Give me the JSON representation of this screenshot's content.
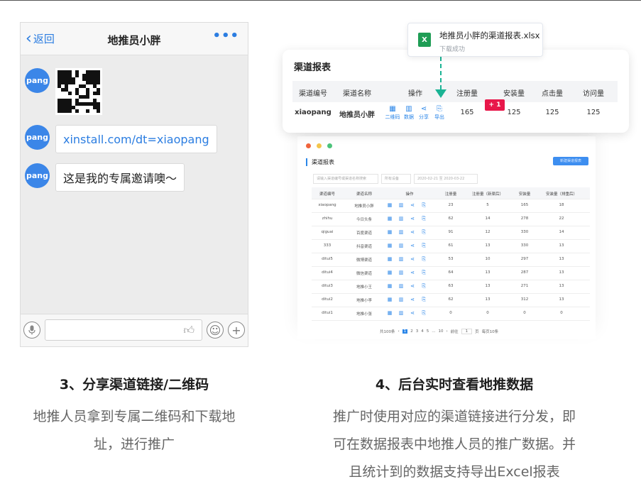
{
  "left": {
    "nav": {
      "back_label": "返回",
      "title": "地推员小胖",
      "more": "•••"
    },
    "messages": [
      {
        "avatar": "pang",
        "type": "qrcode"
      },
      {
        "avatar": "pang",
        "type": "link",
        "text": "xinstall.com/dt=xiaopang"
      },
      {
        "avatar": "pang",
        "type": "text",
        "text": "这是我的专属邀请噢～"
      }
    ],
    "input": {
      "voice_icon": "mic-icon",
      "like_icon": "thumb-icon",
      "emoji_icon": "emoji-icon",
      "add_icon": "plus-icon"
    },
    "caption_title": "3、分享渠道链接/二维码",
    "caption_line1": "地推人员拿到专属二维码和下载地",
    "caption_line2": "址，进行推广"
  },
  "right": {
    "file": {
      "name": "地推员小胖的渠道报表.xlsx",
      "status": "下载成功",
      "icon": "excel-icon"
    },
    "report": {
      "title": "渠道报表",
      "headers": [
        "渠道编号",
        "渠道名称",
        "操作",
        "注册量",
        "安装量",
        "点击量",
        "访问量"
      ],
      "row": {
        "code": "xiaopang",
        "name": "地推员小胖",
        "register": "165",
        "install": "125",
        "click": "125",
        "visit": "125"
      },
      "ops": [
        "二维码",
        "数据",
        "分享",
        "导出"
      ],
      "badge": "+ 1"
    },
    "screen": {
      "title": "渠道报表",
      "button": "新建渠道报表",
      "search_placeholder": "请输入渠道编号或渠道名称搜索",
      "select": "所有设备",
      "date_range": "2020-02-21 至 2020-03-22",
      "headers": [
        "渠道编号",
        "渠道名称",
        "操作",
        "注册量",
        "注册量（新渠后）",
        "安装量",
        "安装量（排重后）"
      ],
      "rows": [
        [
          "xiaopang",
          "地推员小胖",
          "23",
          "5",
          "165",
          "18"
        ],
        [
          "zhihu",
          "今日头条",
          "62",
          "14",
          "278",
          "22"
        ],
        [
          "qiguai",
          "百度渠道",
          "91",
          "12",
          "330",
          "14"
        ],
        [
          "333",
          "抖音渠道",
          "61",
          "13",
          "330",
          "13"
        ],
        [
          "ditui5",
          "微博渠道",
          "53",
          "10",
          "297",
          "13"
        ],
        [
          "ditui4",
          "微信渠道",
          "64",
          "13",
          "287",
          "13"
        ],
        [
          "ditui3",
          "地推小王",
          "63",
          "13",
          "271",
          "13"
        ],
        [
          "ditui2",
          "地推小李",
          "62",
          "13",
          "312",
          "13"
        ],
        [
          "ditui1",
          "地推小张",
          "0",
          "0",
          "0",
          "0"
        ]
      ],
      "pager": {
        "total": "共100条",
        "pages": [
          "1",
          "2",
          "3",
          "4",
          "5",
          "...",
          "10"
        ],
        "goto": "前往",
        "page_input": "1",
        "suffix": "页",
        "page_size": "每页10条"
      }
    },
    "caption_title": "4、后台实时查看地推数据",
    "caption_line1": "推广时使用对应的渠道链接进行分发，即",
    "caption_line2": "可在数据报表中地推人员的推广数据。并",
    "caption_line3": "且统计到的数据支持导出Excel报表"
  },
  "colors": {
    "accent": "#2b86e8",
    "avatar": "#3b86e8",
    "badge": "#e8174a",
    "arrow": "#1ab394",
    "excel": "#1f9d55"
  }
}
